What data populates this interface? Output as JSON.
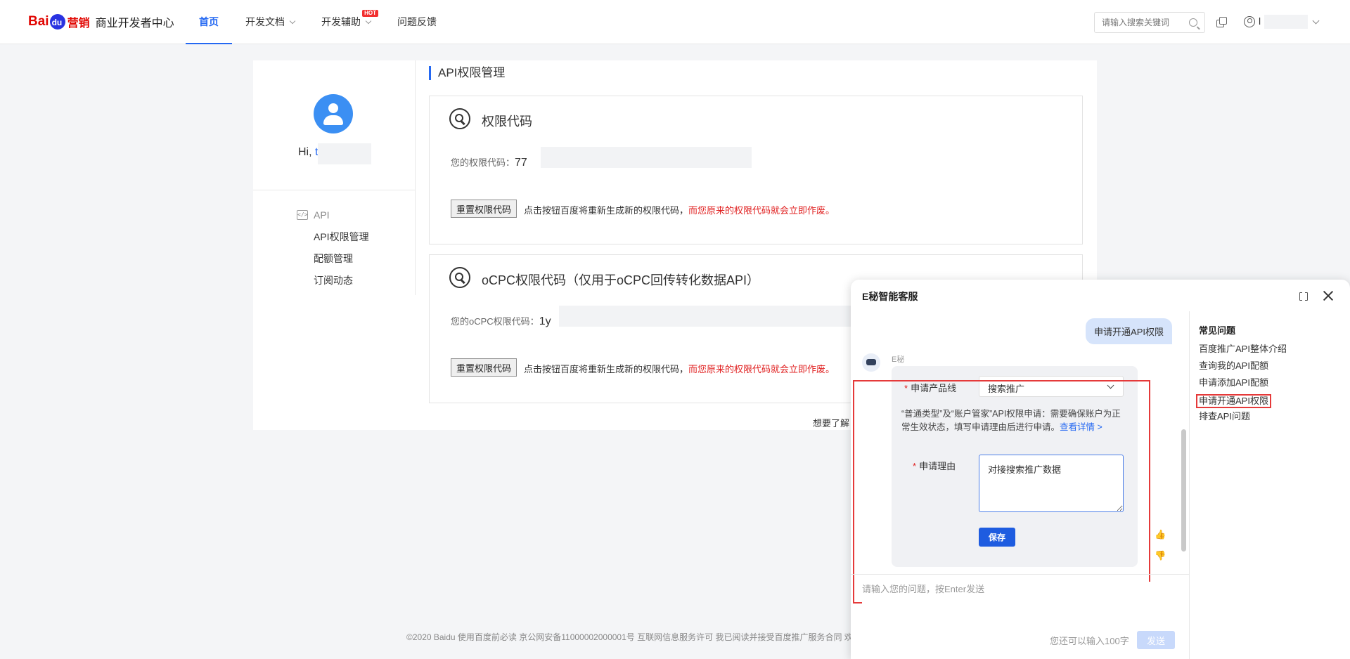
{
  "brand": {
    "logo_bai": "Bai",
    "logo_du": "du",
    "logo_ying": "营销",
    "title": "商业开发者中心"
  },
  "nav": {
    "items": [
      {
        "label": "首页"
      },
      {
        "label": "开发文档"
      },
      {
        "label": "开发辅助"
      },
      {
        "label": "问题反馈"
      }
    ],
    "hot_badge": "HOT"
  },
  "header": {
    "search_placeholder": "请输入搜索关键词",
    "user_initial": "l"
  },
  "profile": {
    "greeting": "Hi, ",
    "greeting_name": "t"
  },
  "side_menu": {
    "head_icon": "</>",
    "head_label": "API",
    "items": [
      {
        "label": "API权限管理"
      },
      {
        "label": "配额管理"
      },
      {
        "label": "订阅动态"
      }
    ]
  },
  "page": {
    "section_title": "API权限管理",
    "boxes": [
      {
        "title": "权限代码",
        "code_label": "您的权限代码：",
        "code_value": "77",
        "reset_label": "重置权限代码",
        "note": "点击按钮百度将重新生成新的权限代码，",
        "note_warning": "而您原来的权限代码就会立即作废。"
      },
      {
        "title": "oCPC权限代码（仅用于oCPC回传转化数据API）",
        "code_label": "您的oCPC权限代码：",
        "code_value": "1y",
        "reset_label": "重置权限代码",
        "note": "点击按钮百度将重新生成新的权限代码，",
        "note_warning": "而您原来的权限代码就会立即作废。"
      }
    ],
    "want_text": "想要了解"
  },
  "footer": {
    "text": "©2020 Baidu 使用百度前必读 京公网安备11000002000001号 互联网信息服务许可 我已阅读并接受百度推广服务合同 欢"
  },
  "chat": {
    "title": "E秘智能客服",
    "user_message": "申请开通API权限",
    "bot_name": "E秘",
    "form": {
      "product_label": "申请产品线",
      "product_value": "搜索推广",
      "tip": "“普通类型”及“账户管家”API权限申请：需要确保账户为正常生效状态，填写申请理由后进行申请。",
      "tip_link": "查看详情 >",
      "reason_label": "申请理由",
      "reason_value": "对接搜索推广数据",
      "save_label": "保存"
    },
    "input_placeholder": "请输入您的问题，按Enter发送",
    "remain_text": "您还可以输入100字",
    "send_label": "发送",
    "faq": {
      "title": "常见问题",
      "items": [
        {
          "label": "百度推广API整体介绍"
        },
        {
          "label": "查询我的API配额"
        },
        {
          "label": "申请添加API配额"
        },
        {
          "label": "申请开通API权限"
        },
        {
          "label": "排查API问题"
        }
      ]
    }
  },
  "colors": {
    "accent": "#2468f2",
    "warning": "#e02020",
    "highlight_frame": "#e53a3a"
  }
}
